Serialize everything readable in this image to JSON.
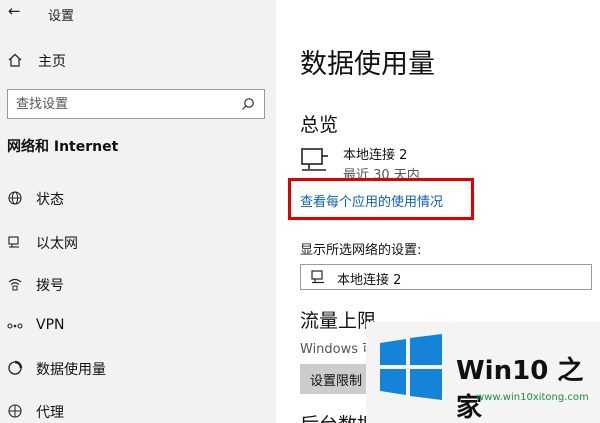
{
  "app": {
    "back_glyph": "←",
    "title": "设置"
  },
  "sidebar": {
    "home_label": "主页",
    "search_placeholder": "查找设置",
    "section_title": "网络和 Internet",
    "items": [
      {
        "label": "状态",
        "icon": "globe-icon"
      },
      {
        "label": "以太网",
        "icon": "ethernet-icon"
      },
      {
        "label": "拨号",
        "icon": "dialup-icon"
      },
      {
        "label": "VPN",
        "icon": "vpn-icon"
      },
      {
        "label": "数据使用量",
        "icon": "data-usage-icon"
      },
      {
        "label": "代理",
        "icon": "proxy-icon"
      }
    ]
  },
  "main": {
    "page_title": "数据使用量",
    "overview_heading": "总览",
    "connection": {
      "name": "本地连接 2",
      "period": "最近 30 天内"
    },
    "usage_link": "查看每个应用的使用情况",
    "network_select_label": "显示所选网络的设置:",
    "network_select_value": "本地连接 2",
    "limit_heading": "流量上限",
    "limit_desc": "Windows 可",
    "limit_button": "设置限制",
    "bg_heading": "后台数据"
  },
  "watermark": {
    "name": "Win10 之家",
    "url": "www.win10xitong.com"
  },
  "colors": {
    "sidebar_bg": "#f2f2f2",
    "link": "#0b62b0",
    "highlight_border": "#e00000",
    "button_bg": "#cccccc",
    "logo_blue": "#1583d8"
  }
}
